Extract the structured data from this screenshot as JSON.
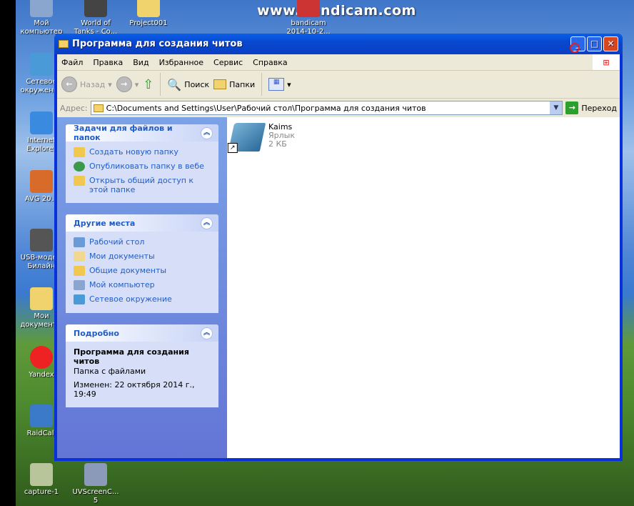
{
  "watermark": "www.Bandicam.com",
  "desktop_icons": [
    {
      "label": "Мой компьютер"
    },
    {
      "label": "World of Tanks - Co..."
    },
    {
      "label": "Project001"
    },
    {
      "label": "bandicam 2014-10-2..."
    },
    {
      "label": "Сетевое окружение"
    },
    {
      "label": "Internet Explorer"
    },
    {
      "label": "AVG 20..."
    },
    {
      "label": "USB-модем Билайн"
    },
    {
      "label": "Мои документы"
    },
    {
      "label": "Yandex"
    },
    {
      "label": "RaidCall"
    },
    {
      "label": "capture-1"
    },
    {
      "label": "UVScreenC... 5"
    }
  ],
  "window": {
    "title": "Программа для создания читов",
    "menu": [
      "Файл",
      "Правка",
      "Вид",
      "Избранное",
      "Сервис",
      "Справка"
    ],
    "toolbar": {
      "back": "Назад",
      "search": "Поиск",
      "folders": "Папки"
    },
    "address": {
      "label": "Адрес:",
      "value": "C:\\Documents and Settings\\User\\Рабочий стол\\Программа для создания читов",
      "go": "Переход"
    },
    "tasks": {
      "title": "Задачи для файлов и папок",
      "items": [
        "Создать новую папку",
        "Опубликовать папку в вебе",
        "Открыть общий доступ к этой папке"
      ]
    },
    "places": {
      "title": "Другие места",
      "items": [
        "Рабочий стол",
        "Мои документы",
        "Общие документы",
        "Мой компьютер",
        "Сетевое окружение"
      ]
    },
    "details": {
      "title": "Подробно",
      "name": "Программа для создания читов",
      "type": "Папка с файлами",
      "modified": "Изменен: 22 октября 2014 г., 19:49"
    },
    "files": [
      {
        "name": "Kaims",
        "type": "Ярлык",
        "size": "2 КБ"
      }
    ]
  },
  "colors": {
    "titlebar": "#0a4fd6",
    "link": "#215dc6",
    "pane": "#6f8ede"
  }
}
